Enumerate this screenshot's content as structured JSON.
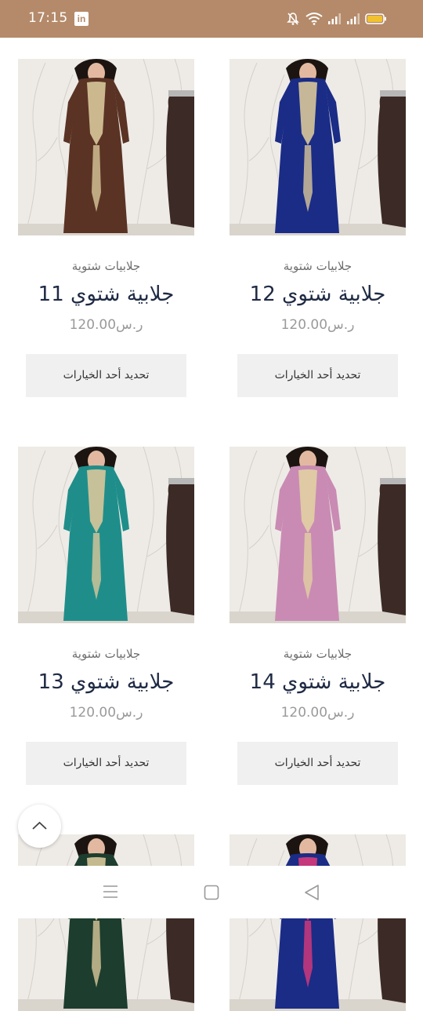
{
  "status_bar": {
    "time": "17:15",
    "app_badge": "in",
    "icons": [
      "linkedin-icon",
      "mute-bell-icon",
      "wifi-icon",
      "signal-icon",
      "signal-icon",
      "battery-icon"
    ]
  },
  "products": [
    {
      "category": "جلابيات شتوية",
      "title": "جلابية شتوي 11",
      "price": "120.00ر.س",
      "button": "تحديد أحد الخيارات",
      "dress_color": "#5a3324",
      "accent": "#d8c79a"
    },
    {
      "category": "جلابيات شتوية",
      "title": "جلابية شتوي 12",
      "price": "120.00ر.س",
      "button": "تحديد أحد الخيارات",
      "dress_color": "#1b2c86",
      "accent": "#d8c79a"
    },
    {
      "category": "جلابيات شتوية",
      "title": "جلابية شتوي 13",
      "price": "120.00ر.س",
      "button": "تحديد أحد الخيارات",
      "dress_color": "#1f8e8a",
      "accent": "#d8c79a"
    },
    {
      "category": "جلابيات شتوية",
      "title": "جلابية شتوي 14",
      "price": "120.00ر.س",
      "button": "تحديد أحد الخيارات",
      "dress_color": "#c98bb3",
      "accent": "#e2cfa3"
    },
    {
      "dress_color": "#1d3d2e",
      "accent": "#d8c79a"
    },
    {
      "dress_color": "#1b2c86",
      "accent": "#d83a7a"
    }
  ],
  "scroll_top_icon": "chevron-up-icon",
  "nav_bar": {
    "icons": [
      "menu-icon",
      "home-square-icon",
      "back-triangle-icon"
    ]
  },
  "colors": {
    "status_bar": "#b48a6a",
    "title": "#1f2a44",
    "button_bg": "#f0f0f0"
  }
}
